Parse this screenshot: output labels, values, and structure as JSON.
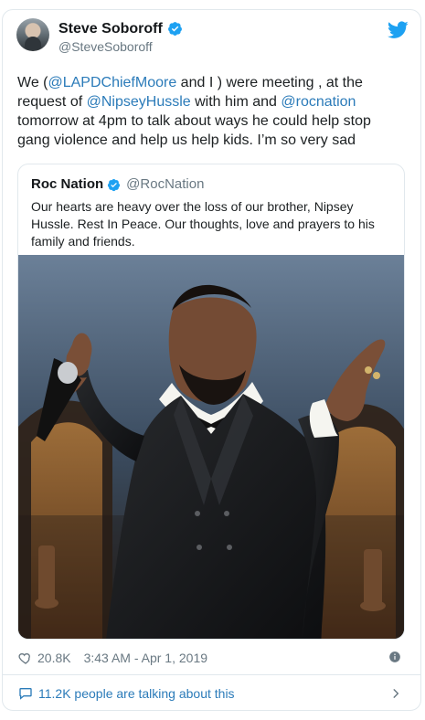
{
  "author": {
    "name": "Steve Soboroff",
    "handle": "@SteveSoboroff"
  },
  "tweet": {
    "prefix": "We (",
    "mention_1": "@LAPDChiefMoore",
    "middle_1": " and I ) were meeting , at the request of  ",
    "mention_2": "@NipseyHussle",
    "middle_2": " with him and ",
    "mention_3": "@rocnation",
    "suffix": " tomorrow at 4pm to talk about ways he could help stop gang violence and help us help kids.    I’m so very sad"
  },
  "quoted_tweet": {
    "name": "Roc Nation",
    "handle": "@RocNation",
    "text": "Our hearts are heavy over the loss of our brother, Nipsey Hussle. Rest In Peace. Our thoughts, love and prayers to his family and friends."
  },
  "footer": {
    "likes": "20.8K",
    "timestamp": "3:43 AM - Apr 1, 2019",
    "conversation": "11.2K people are talking about this"
  },
  "colors": {
    "link": "#2b7bb9",
    "muted": "#697882",
    "border": "#e1e8ed",
    "twitter_blue": "#1da1f2"
  },
  "icons": {
    "verified": "verified-badge-icon",
    "twitter": "twitter-bird-icon",
    "heart": "heart-icon",
    "info": "info-icon",
    "conversation": "speech-bubble-icon",
    "chevron": "chevron-right-icon"
  }
}
